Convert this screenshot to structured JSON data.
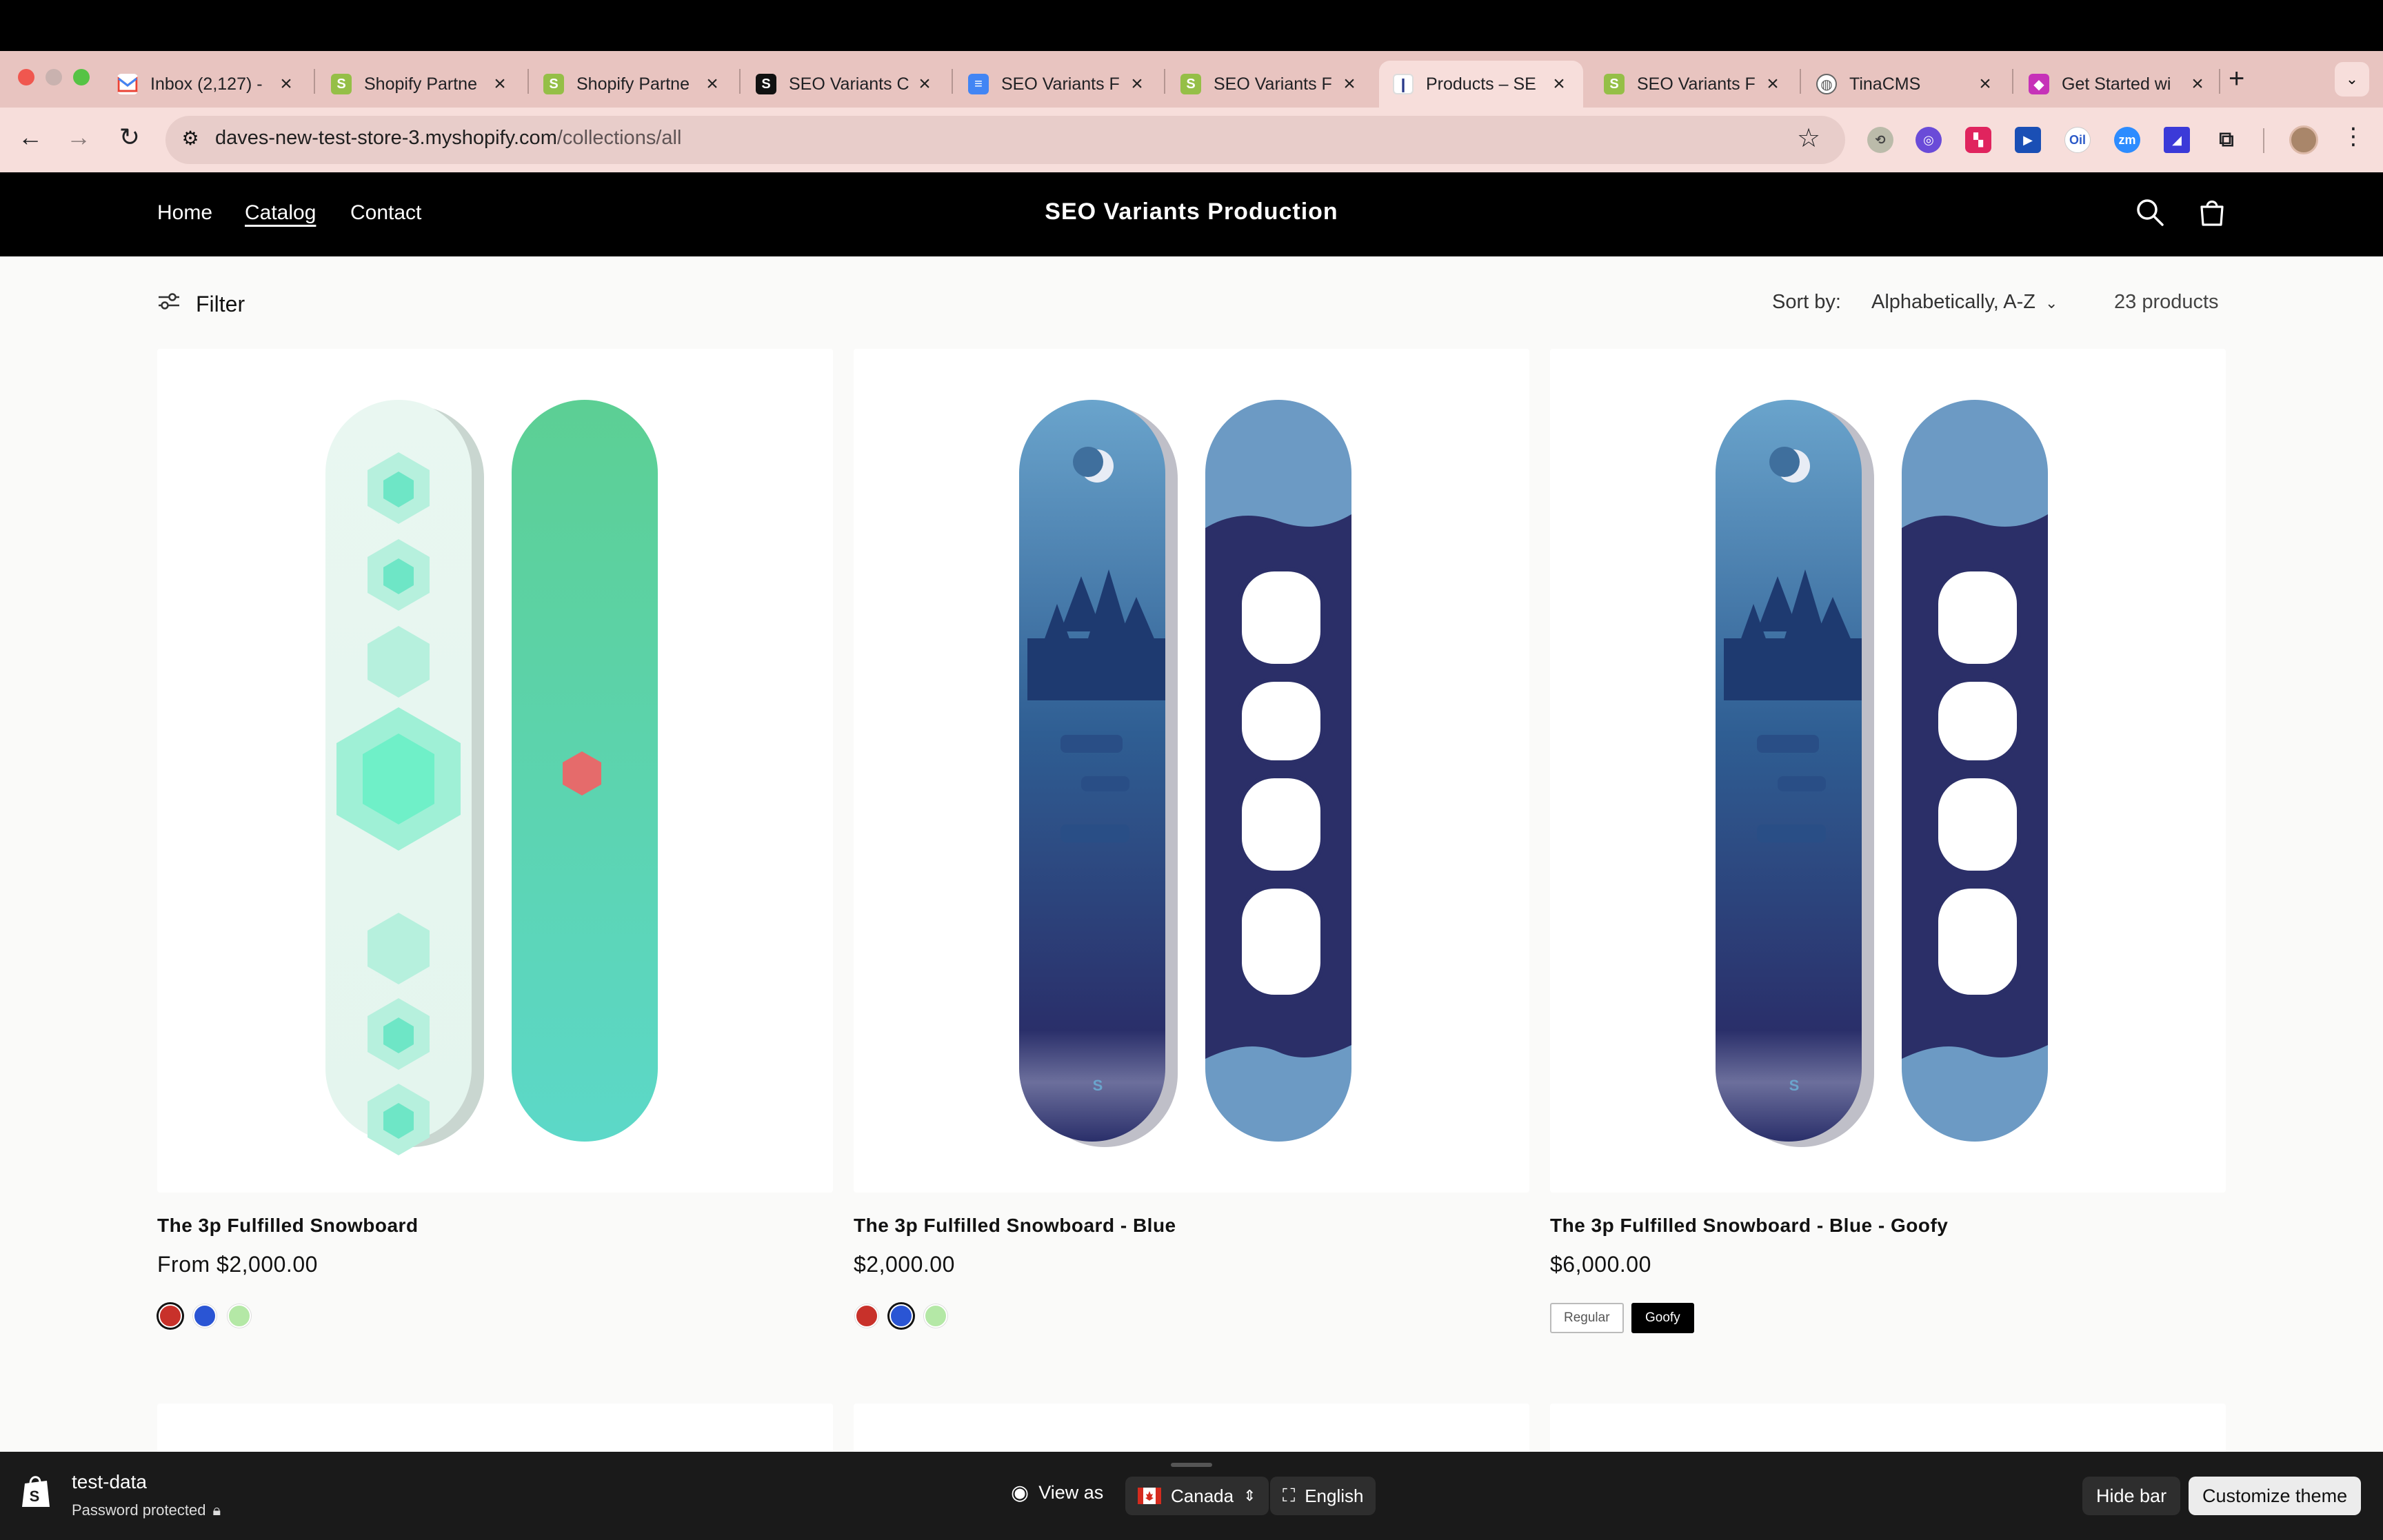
{
  "browser": {
    "tabs": [
      {
        "title": "Inbox (2,127) -",
        "icon": "gmail-icon"
      },
      {
        "title": "Shopify Partne",
        "icon": "shopify-icon"
      },
      {
        "title": "Shopify Partne",
        "icon": "shopify-icon"
      },
      {
        "title": "SEO Variants C",
        "icon": "shopify-dark-icon"
      },
      {
        "title": "SEO Variants F",
        "icon": "docs-icon"
      },
      {
        "title": "SEO Variants F",
        "icon": "shopify-icon"
      },
      {
        "title": "Products – SE",
        "icon": "store-icon",
        "active": true
      },
      {
        "title": "SEO Variants F",
        "icon": "shopify-icon"
      },
      {
        "title": "TinaCMS",
        "icon": "globe-icon"
      },
      {
        "title": "Get Started wi",
        "icon": "app-icon"
      }
    ],
    "url_host": "daves-new-test-store-3.myshopify.com",
    "url_path": "/collections/all"
  },
  "store": {
    "nav": [
      "Home",
      "Catalog",
      "Contact"
    ],
    "title": "SEO Variants Production"
  },
  "collection": {
    "filter_label": "Filter",
    "sort_label": "Sort by:",
    "sort_value": "Alphabetically, A-Z",
    "count": "23 products"
  },
  "products": [
    {
      "title": "The 3p Fulfilled Snowboard",
      "price": "From $2,000.00",
      "swatches": [
        "#c8312a",
        "#2a55d4",
        "#b4e8a6"
      ],
      "selected_swatch": 0
    },
    {
      "title": "The 3p Fulfilled Snowboard - Blue",
      "price": "$2,000.00",
      "swatches": [
        "#c8312a",
        "#2a55d4",
        "#b4e8a6"
      ],
      "selected_swatch": 1
    },
    {
      "title": "The 3p Fulfilled Snowboard - Blue - Goofy",
      "price": "$6,000.00",
      "options": [
        "Regular",
        "Goofy"
      ],
      "selected_option": 1
    }
  ],
  "preview_bar": {
    "store_name": "test-data",
    "status": "Password protected",
    "view_as": "View as",
    "country": "Canada",
    "language": "English",
    "hide_bar": "Hide bar",
    "customize": "Customize theme"
  }
}
